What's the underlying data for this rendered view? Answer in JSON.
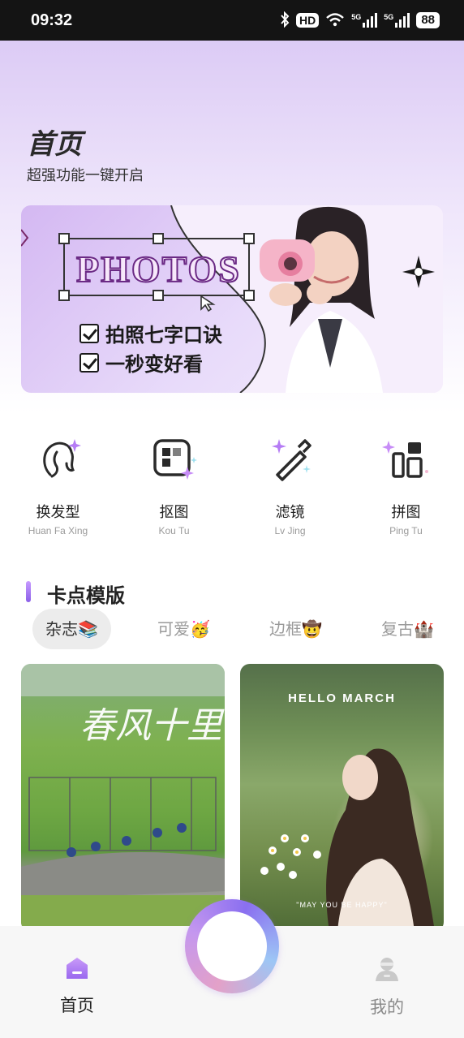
{
  "status_bar": {
    "time": "09:32",
    "hd_label": "HD",
    "net1": "5G",
    "net2": "5G",
    "battery": "88"
  },
  "header": {
    "title": "首页",
    "subtitle": "超强功能一键开启"
  },
  "banner": {
    "word": "PHOTOS",
    "line1": "拍照七字口诀",
    "line2": "一秒变好看"
  },
  "features": [
    {
      "name": "换发型",
      "pinyin": "Huan Fa Xing",
      "icon": "hair-icon"
    },
    {
      "name": "抠图",
      "pinyin": "Kou Tu",
      "icon": "cutout-icon"
    },
    {
      "name": "滤镜",
      "pinyin": "Lv Jing",
      "icon": "filter-wand-icon"
    },
    {
      "name": "拼图",
      "pinyin": "Ping Tu",
      "icon": "collage-icon"
    }
  ],
  "section": {
    "title": "卡点模版",
    "tabs": [
      "杂志📚",
      "可爱🥳",
      "边框🤠",
      "复古🏰"
    ],
    "active_tab": "杂志📚"
  },
  "cards": {
    "card2_caption": "HELLO MARCH",
    "card2_quote": "\"MAY YOU BE HAPPY\"",
    "card1_script": "春风十里"
  },
  "bottom_nav": {
    "home": "首页",
    "mine": "我的"
  },
  "colors": {
    "accent": "#9b6cf0",
    "header_bg": "#dccbf5"
  }
}
